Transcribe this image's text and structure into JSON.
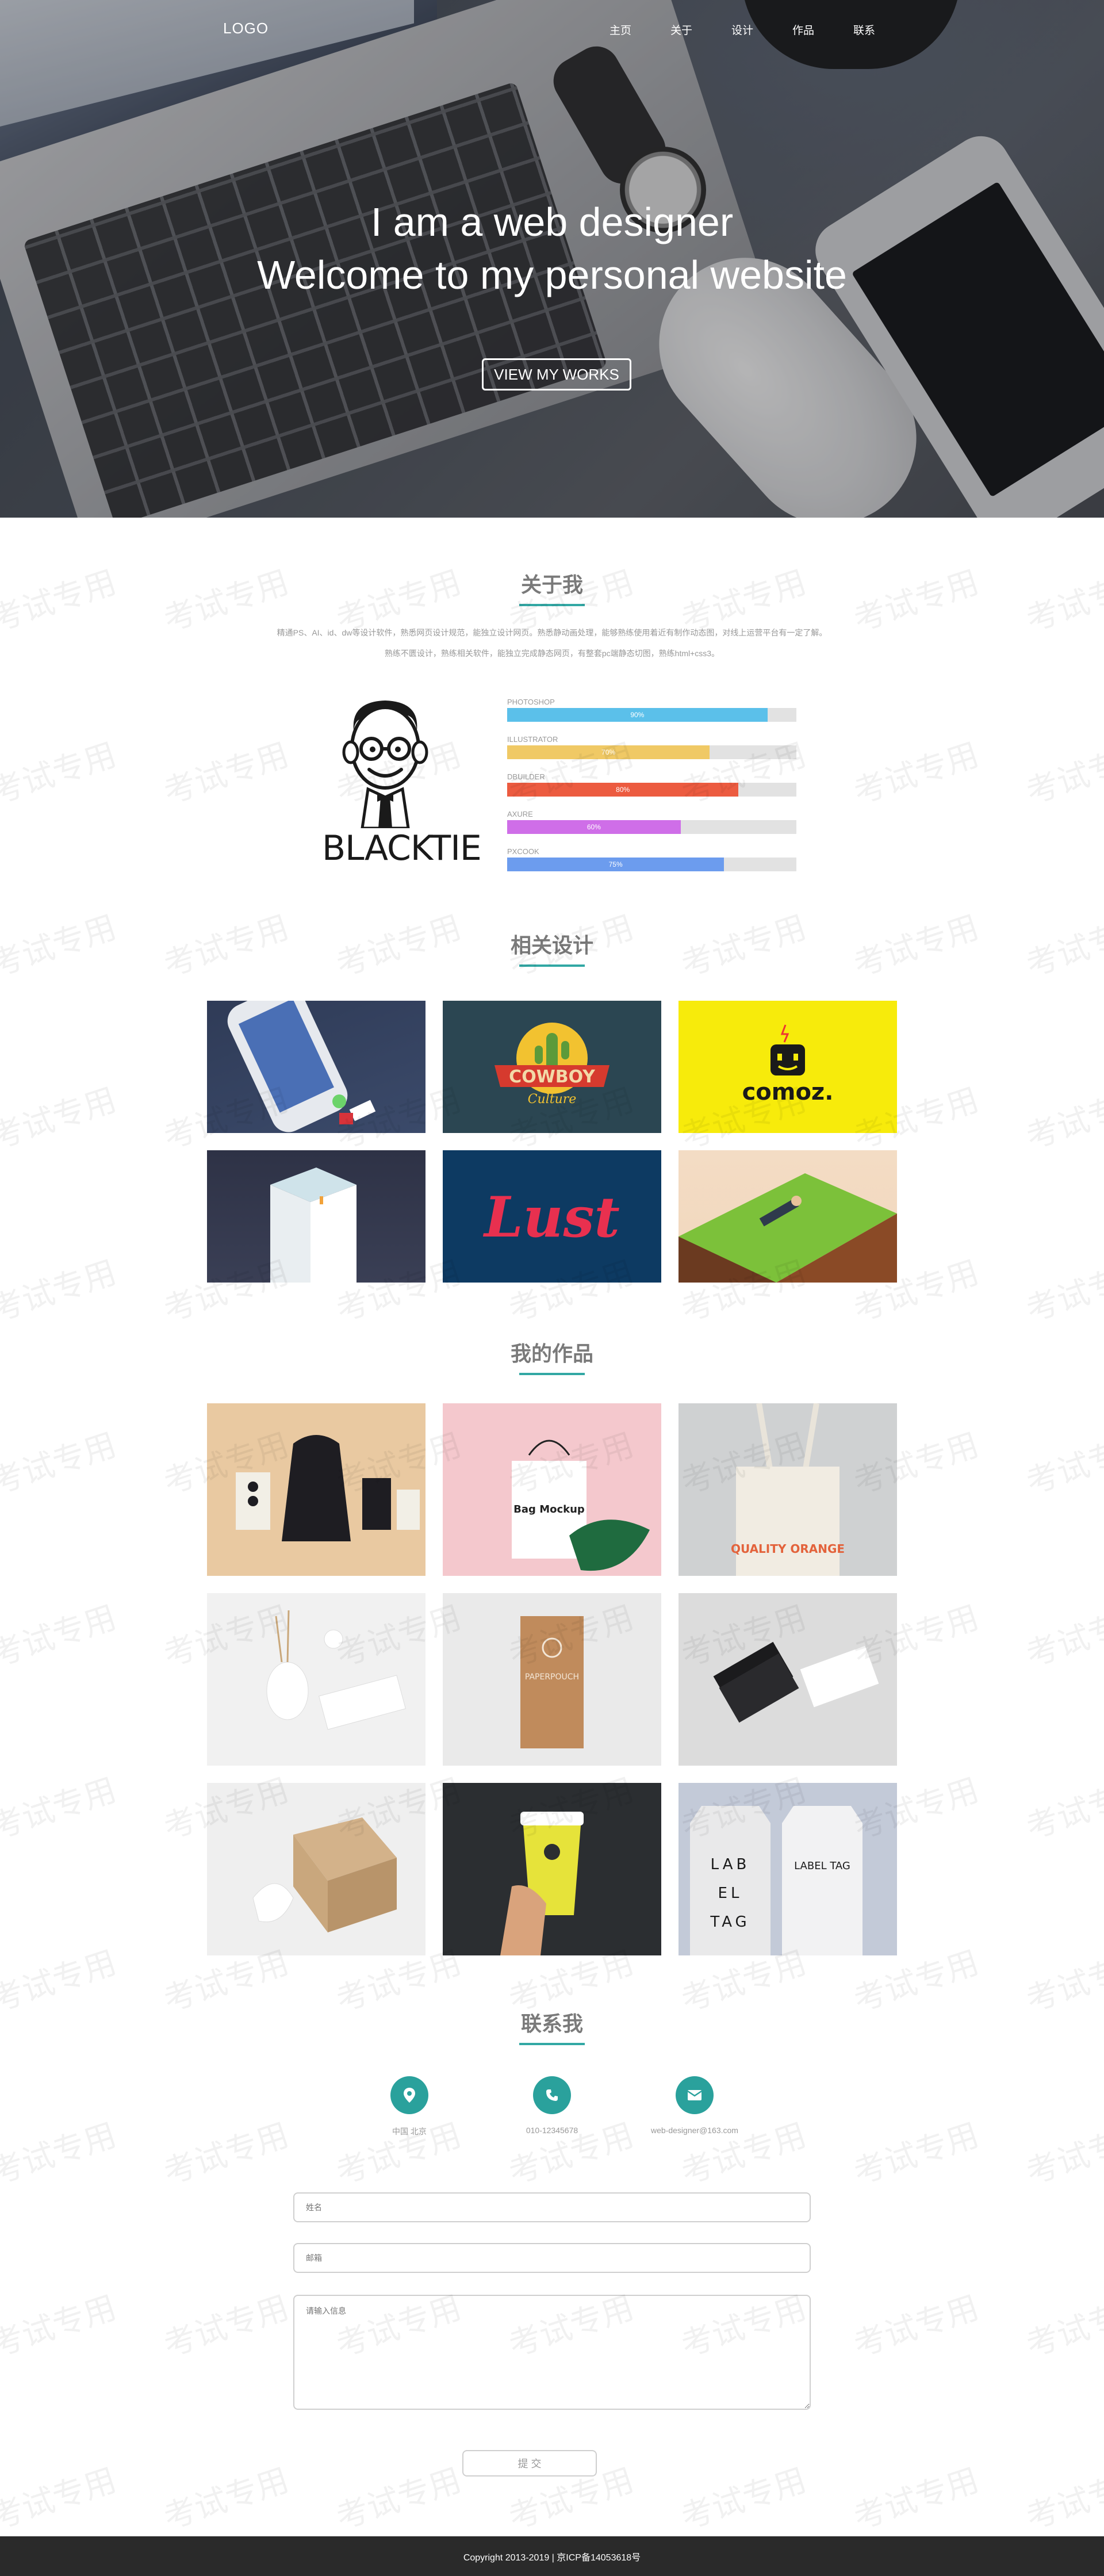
{
  "nav": {
    "logo": "LOGO",
    "links": [
      "主页",
      "关于",
      "设计",
      "作品",
      "联系"
    ]
  },
  "hero": {
    "line1": "I am a web designer",
    "line2": "Welcome to my personal website",
    "button": "VIEW MY WORKS"
  },
  "about": {
    "title": "关于我",
    "text1": "精通PS、AI、id、dw等设计软件，熟悉网页设计规范，能独立设计网页。熟悉静动画处理，能够熟练使用着近有制作动态图，对线上运营平台有一定了解。",
    "text2": "熟练不匮设计，熟练相关软件，能独立完成静态网页，有整套pc端静态切图，熟练html+css3。",
    "brand": "BLACKTIE",
    "skills": [
      {
        "name": "PHOTOSHOP",
        "percent": 90,
        "label": "90%",
        "color": "#5bc0ea"
      },
      {
        "name": "ILLUSTRATOR",
        "percent": 70,
        "label": "70%",
        "color": "#f0c965"
      },
      {
        "name": "DBUILDER",
        "percent": 80,
        "label": "80%",
        "color": "#ec5b40"
      },
      {
        "name": "AXURE",
        "percent": 60,
        "label": "60%",
        "color": "#cf6ee8"
      },
      {
        "name": "PXCOOK",
        "percent": 75,
        "label": "75%",
        "color": "#6c9cee"
      }
    ]
  },
  "design": {
    "title": "相关设计",
    "items": [
      {
        "caption": ""
      },
      {
        "caption": "COWBOY"
      },
      {
        "caption": "comoz."
      },
      {
        "caption": ""
      },
      {
        "caption": "Lust"
      },
      {
        "caption": ""
      }
    ]
  },
  "works": {
    "title": "我的作品",
    "items": [
      {
        "caption": ""
      },
      {
        "caption": "Bag Mockup"
      },
      {
        "caption": "QUALITY ORANGE"
      },
      {
        "caption": ""
      },
      {
        "caption": "PAPERPOUCH"
      },
      {
        "caption": ""
      },
      {
        "caption": ""
      },
      {
        "caption": ""
      },
      {
        "caption": "LABEL TAG"
      }
    ]
  },
  "contact": {
    "title": "联系我",
    "items": [
      {
        "icon": "location-icon",
        "text": "中国 北京"
      },
      {
        "icon": "phone-icon",
        "text": "010-12345678"
      },
      {
        "icon": "mail-icon",
        "text": "web-designer@163.com"
      }
    ],
    "form": {
      "name_placeholder": "姓名",
      "email_placeholder": "邮箱",
      "message_placeholder": "请输入信息",
      "submit": "提 交"
    }
  },
  "footer": {
    "text": "Copyright  2013-2019    |  京ICP备14053618号"
  },
  "watermark": "考试专用",
  "colors": {
    "accent": "#2aa19c",
    "footer": "#2a2a2a"
  }
}
